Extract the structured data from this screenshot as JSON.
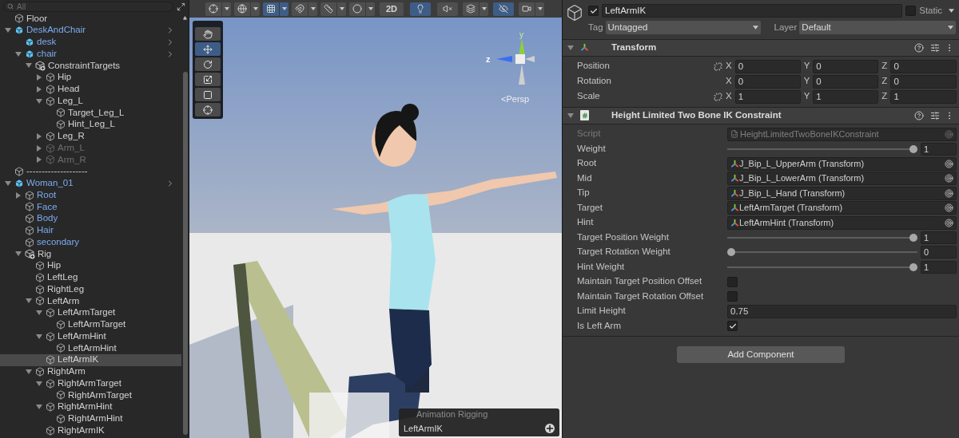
{
  "hierarchy": {
    "search": {
      "placeholder": "All"
    },
    "items": [
      {
        "name": "Floor",
        "kind": "object",
        "selected": false,
        "disabled": false
      },
      {
        "name": "DeskAndChair",
        "kind": "prefab_root",
        "expanded": true,
        "selected": false,
        "disabled": false,
        "children": [
          {
            "name": "desk",
            "kind": "prefab_root",
            "selected": false,
            "disabled": false
          },
          {
            "name": "chair",
            "kind": "prefab_root",
            "expanded": true,
            "selected": false,
            "disabled": false,
            "children": [
              {
                "name": "ConstraintTargets",
                "kind": "rig",
                "expanded": true,
                "selected": false,
                "disabled": false,
                "children": [
                  {
                    "name": "Hip",
                    "kind": "object",
                    "expanded": false,
                    "selected": false,
                    "disabled": false
                  },
                  {
                    "name": "Head",
                    "kind": "object",
                    "expanded": false,
                    "selected": false,
                    "disabled": false
                  },
                  {
                    "name": "Leg_L",
                    "kind": "object",
                    "expanded": true,
                    "selected": false,
                    "disabled": false,
                    "children": [
                      {
                        "name": "Target_Leg_L",
                        "kind": "object",
                        "selected": false,
                        "disabled": false
                      },
                      {
                        "name": "Hint_Leg_L",
                        "kind": "object",
                        "selected": false,
                        "disabled": false
                      }
                    ]
                  },
                  {
                    "name": "Leg_R",
                    "kind": "object",
                    "expanded": false,
                    "selected": false,
                    "disabled": false
                  },
                  {
                    "name": "Arm_L",
                    "kind": "object",
                    "expanded": false,
                    "selected": false,
                    "disabled": true
                  },
                  {
                    "name": "Arm_R",
                    "kind": "object",
                    "expanded": false,
                    "selected": false,
                    "disabled": true
                  }
                ]
              }
            ]
          }
        ]
      },
      {
        "name": "--------------------",
        "kind": "object",
        "selected": false,
        "disabled": false
      },
      {
        "name": "Woman_01",
        "kind": "prefab_root",
        "expanded": true,
        "selected": false,
        "disabled": false,
        "children": [
          {
            "name": "Root",
            "kind": "prefab_part",
            "expanded": false,
            "selected": false,
            "disabled": false
          },
          {
            "name": "Face",
            "kind": "prefab_part",
            "selected": false,
            "disabled": false
          },
          {
            "name": "Body",
            "kind": "prefab_part",
            "selected": false,
            "disabled": false
          },
          {
            "name": "Hair",
            "kind": "prefab_part",
            "selected": false,
            "disabled": false
          },
          {
            "name": "secondary",
            "kind": "prefab_part",
            "selected": false,
            "disabled": false
          },
          {
            "name": "Rig",
            "kind": "rig",
            "expanded": true,
            "selected": false,
            "disabled": false,
            "children": [
              {
                "name": "Hip",
                "kind": "object",
                "selected": false,
                "disabled": false
              },
              {
                "name": "LeftLeg",
                "kind": "object",
                "selected": false,
                "disabled": false
              },
              {
                "name": "RightLeg",
                "kind": "object",
                "selected": false,
                "disabled": false
              },
              {
                "name": "LeftArm",
                "kind": "object",
                "expanded": true,
                "selected": false,
                "disabled": false,
                "children": [
                  {
                    "name": "LeftArmTarget",
                    "kind": "object",
                    "expanded": true,
                    "selected": false,
                    "disabled": false,
                    "children": [
                      {
                        "name": "LeftArmTarget",
                        "kind": "object",
                        "selected": false,
                        "disabled": false
                      }
                    ]
                  },
                  {
                    "name": "LeftArmHint",
                    "kind": "object",
                    "expanded": true,
                    "selected": false,
                    "disabled": false,
                    "children": [
                      {
                        "name": "LeftArmHint",
                        "kind": "object",
                        "selected": false,
                        "disabled": false
                      }
                    ]
                  },
                  {
                    "name": "LeftArmIK",
                    "kind": "object",
                    "selected": true,
                    "disabled": false
                  }
                ]
              },
              {
                "name": "RightArm",
                "kind": "object",
                "expanded": true,
                "selected": false,
                "disabled": false,
                "children": [
                  {
                    "name": "RightArmTarget",
                    "kind": "object",
                    "expanded": true,
                    "selected": false,
                    "disabled": false,
                    "children": [
                      {
                        "name": "RightArmTarget",
                        "kind": "object",
                        "selected": false,
                        "disabled": false
                      }
                    ]
                  },
                  {
                    "name": "RightArmHint",
                    "kind": "object",
                    "expanded": true,
                    "selected": false,
                    "disabled": false,
                    "children": [
                      {
                        "name": "RightArmHint",
                        "kind": "object",
                        "selected": false,
                        "disabled": false
                      }
                    ]
                  },
                  {
                    "name": "RightArmIK",
                    "kind": "object",
                    "selected": false,
                    "disabled": false
                  }
                ]
              }
            ]
          }
        ]
      }
    ]
  },
  "scene": {
    "toolbar": [
      {
        "kind": "gizmo",
        "dropdown": true,
        "selected": false
      },
      {
        "kind": "globe",
        "dropdown": true,
        "selected": false
      },
      {
        "kind": "grid",
        "dropdown": true,
        "selected": true
      },
      {
        "kind": "snap",
        "dropdown": true,
        "selected": false
      },
      {
        "kind": "ruler",
        "dropdown": true,
        "selected": false
      },
      {
        "kind": "shading",
        "dropdown": true,
        "selected": false
      },
      {
        "kind": "text",
        "text": "2D",
        "dropdown": false,
        "selected": false
      },
      {
        "kind": "light",
        "dropdown": false,
        "selected": true
      },
      {
        "kind": "audio",
        "dropdown": false,
        "selected": false
      },
      {
        "kind": "effects",
        "dropdown": true,
        "selected": false
      },
      {
        "kind": "hidden",
        "dropdown": false,
        "selected": true
      },
      {
        "kind": "camera",
        "dropdown": true,
        "selected": false
      }
    ],
    "tools": [
      {
        "kind": "hand",
        "selected": false
      },
      {
        "kind": "move",
        "selected": true
      },
      {
        "kind": "rotate",
        "selected": false
      },
      {
        "kind": "scale",
        "selected": false
      },
      {
        "kind": "rect",
        "selected": false
      },
      {
        "kind": "transform",
        "selected": false
      }
    ],
    "gizmo": {
      "y": "y",
      "z": "z",
      "projection": "<Persp"
    },
    "overlay": {
      "title": "Animation Rigging",
      "item": "LeftArmIK"
    }
  },
  "inspector": {
    "object": {
      "enabled": true,
      "name": "LeftArmIK",
      "static": false,
      "static_label": "Static",
      "tag_label": "Tag",
      "tag": "Untagged",
      "layer_label": "Layer",
      "layer": "Default"
    },
    "transform": {
      "expanded": true,
      "title": "Transform",
      "rows": [
        {
          "label": "Position",
          "linked": false,
          "values": [
            {
              "axis": "X",
              "value": "0"
            },
            {
              "axis": "Y",
              "value": "0"
            },
            {
              "axis": "Z",
              "value": "0"
            }
          ]
        },
        {
          "label": "Rotation",
          "values": [
            {
              "axis": "X",
              "value": "0"
            },
            {
              "axis": "Y",
              "value": "0"
            },
            {
              "axis": "Z",
              "value": "0"
            }
          ]
        },
        {
          "label": "Scale",
          "linked": false,
          "values": [
            {
              "axis": "X",
              "value": "1"
            },
            {
              "axis": "Y",
              "value": "1"
            },
            {
              "axis": "Z",
              "value": "1"
            }
          ]
        }
      ]
    },
    "component": {
      "expanded": true,
      "title": "Height Limited Two Bone IK Constraint",
      "fields": [
        {
          "kind": "script",
          "label": "Script",
          "value": "HeightLimitedTwoBoneIKConstraint"
        },
        {
          "kind": "slider",
          "label": "Weight",
          "level": 1,
          "value": "1"
        },
        {
          "kind": "object",
          "label": "Root",
          "value": "J_Bip_L_UpperArm (Transform)"
        },
        {
          "kind": "object",
          "label": "Mid",
          "value": "J_Bip_L_LowerArm (Transform)"
        },
        {
          "kind": "object",
          "label": "Tip",
          "value": "J_Bip_L_Hand (Transform)"
        },
        {
          "kind": "object",
          "label": "Target",
          "value": "LeftArmTarget (Transform)"
        },
        {
          "kind": "object",
          "label": "Hint",
          "value": "LeftArmHint (Transform)"
        },
        {
          "kind": "slider",
          "label": "Target Position Weight",
          "level": 1,
          "value": "1"
        },
        {
          "kind": "slider",
          "label": "Target Rotation Weight",
          "level": 0,
          "value": "0"
        },
        {
          "kind": "slider",
          "label": "Hint Weight",
          "level": 1,
          "value": "1"
        },
        {
          "kind": "checkbox",
          "label": "Maintain Target Position Offset",
          "checked": false
        },
        {
          "kind": "checkbox",
          "label": "Maintain Target Rotation Offset",
          "checked": false
        },
        {
          "kind": "number",
          "label": "Limit Height",
          "value": "0.75"
        },
        {
          "kind": "checkbox",
          "label": "Is Left Arm",
          "checked": true
        }
      ]
    },
    "add_component": "Add Component"
  }
}
